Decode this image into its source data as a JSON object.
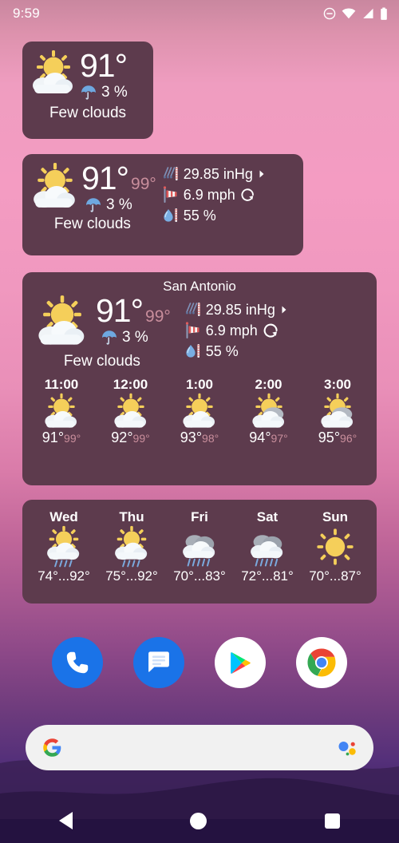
{
  "status_bar": {
    "time": "9:59",
    "icons": [
      "dnd-icon",
      "wifi-icon",
      "cellular-signal-icon",
      "battery-icon"
    ]
  },
  "widget_small": {
    "temp": "91°",
    "precip_probability": "3 %",
    "condition": "Few clouds",
    "weather_icon": "few-clouds-icon",
    "precip_icon": "umbrella-icon"
  },
  "widget_medium": {
    "temp": "91°",
    "feels_like": "99°",
    "precip_probability": "3 %",
    "condition": "Few clouds",
    "weather_icon": "few-clouds-icon",
    "details": [
      {
        "icon": "barometer-icon",
        "value": "29.85 inHg",
        "trailing": "arrow-right-icon"
      },
      {
        "icon": "windsock-icon",
        "value": "6.9 mph",
        "trailing": "wind-direction-icon"
      },
      {
        "icon": "humidity-droplet-icon",
        "value": "55 %",
        "trailing": ""
      }
    ]
  },
  "widget_large": {
    "location": "San Antonio",
    "temp": "91°",
    "feels_like": "99°",
    "precip_probability": "3 %",
    "condition": "Few clouds",
    "weather_icon": "few-clouds-icon",
    "details": [
      {
        "icon": "barometer-icon",
        "value": "29.85 inHg",
        "trailing": "arrow-right-icon"
      },
      {
        "icon": "windsock-icon",
        "value": "6.9 mph",
        "trailing": "wind-direction-icon"
      },
      {
        "icon": "humidity-droplet-icon",
        "value": "55 %",
        "trailing": ""
      }
    ],
    "hourly": [
      {
        "time": "11:00",
        "temp": "91°",
        "feels_like": "99°",
        "icon": "few-clouds-icon"
      },
      {
        "time": "12:00",
        "temp": "92°",
        "feels_like": "99°",
        "icon": "few-clouds-icon"
      },
      {
        "time": "1:00",
        "temp": "93°",
        "feels_like": "98°",
        "icon": "few-clouds-icon"
      },
      {
        "time": "2:00",
        "temp": "94°",
        "feels_like": "97°",
        "icon": "partly-cloudy-icon"
      },
      {
        "time": "3:00",
        "temp": "95°",
        "feels_like": "96°",
        "icon": "partly-cloudy-icon"
      }
    ]
  },
  "widget_daily": {
    "days": [
      {
        "name": "Wed",
        "range": "74°...92°",
        "icon": "sun-rain-icon"
      },
      {
        "name": "Thu",
        "range": "75°...92°",
        "icon": "sun-rain-icon"
      },
      {
        "name": "Fri",
        "range": "70°...83°",
        "icon": "rain-icon"
      },
      {
        "name": "Sat",
        "range": "72°...81°",
        "icon": "rain-icon"
      },
      {
        "name": "Sun",
        "range": "70°...87°",
        "icon": "sunny-icon"
      }
    ]
  },
  "dock": {
    "items": [
      {
        "name": "phone-app-icon",
        "label": "Phone"
      },
      {
        "name": "messages-app-icon",
        "label": "Messages"
      },
      {
        "name": "play-store-app-icon",
        "label": "Play Store"
      },
      {
        "name": "chrome-app-icon",
        "label": "Chrome"
      }
    ]
  },
  "search": {
    "placeholder": "",
    "value": "",
    "left_icon": "google-g-icon",
    "right_icon": "google-assistant-icon"
  },
  "nav_bar": {
    "back": "back-button",
    "home": "home-button",
    "recents": "recents-button"
  },
  "colors": {
    "widget_background": "#5d3b4d",
    "feels_like_text": "#c98e9c",
    "accent_sun": "#f5c84a",
    "search_background": "#f1f1f1"
  }
}
